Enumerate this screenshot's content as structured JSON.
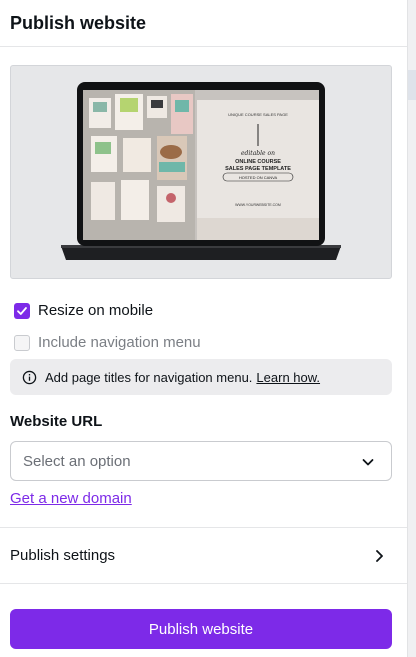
{
  "header": {
    "title": "Publish website"
  },
  "preview": {
    "page_text": {
      "small_top": "UNIQUE COURSE SALES PAGE",
      "script": "editable on",
      "title1": "ONLINE COURSE",
      "title2": "SALES PAGE TEMPLATE",
      "hosted": "HOSTED ON CANVA",
      "url": "WWW.YOURWEBSITE.COM"
    }
  },
  "options": {
    "resize_on_mobile": {
      "label": "Resize on mobile",
      "checked": true
    },
    "include_nav_menu": {
      "label": "Include navigation menu",
      "checked": false
    }
  },
  "info": {
    "text": "Add page titles for navigation menu.",
    "link": "Learn how."
  },
  "website_url": {
    "label": "Website URL",
    "placeholder": "Select an option"
  },
  "domain_link": "Get a new domain",
  "publish_settings": "Publish settings",
  "publish_button": "Publish website",
  "colors": {
    "accent": "#7d2ae8",
    "text": "#0e1318",
    "muted": "#7b7f85"
  }
}
